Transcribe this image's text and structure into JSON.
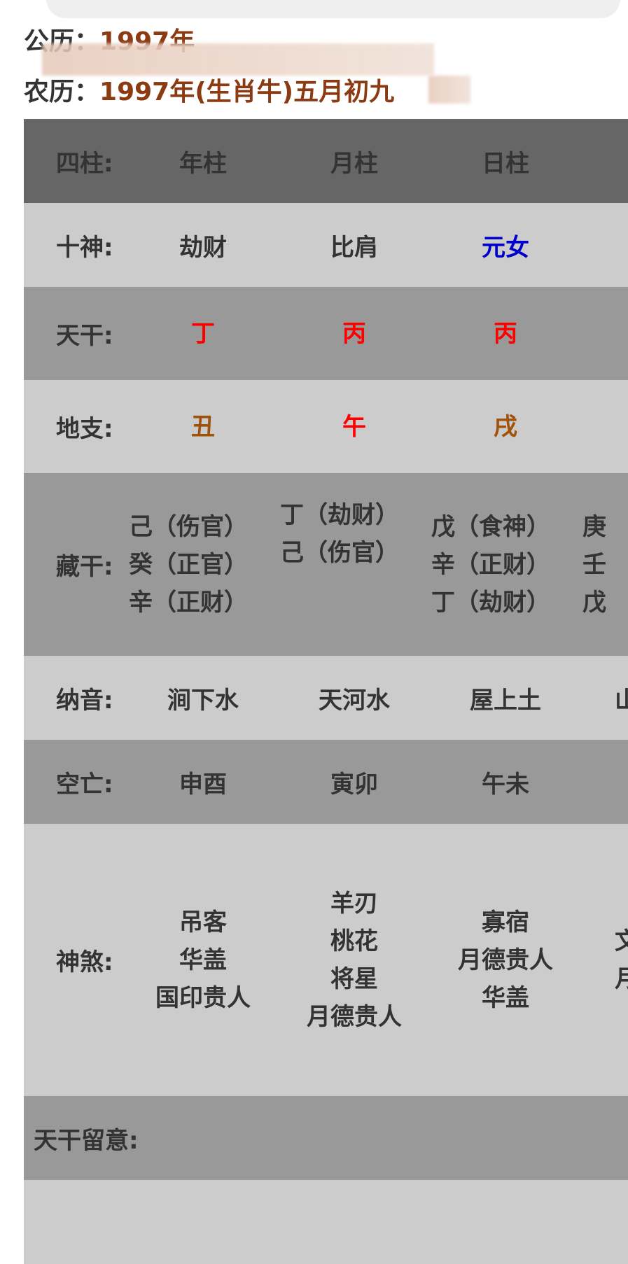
{
  "header": {
    "solar": {
      "label": "公历：",
      "value": "1997年"
    },
    "lunar": {
      "label": "农历：",
      "value": "1997年(生肖牛)五月初九"
    }
  },
  "table": {
    "pillars": {
      "label": "四柱:",
      "values": [
        "年柱",
        "月柱",
        "日柱",
        ""
      ]
    },
    "ten_gods": {
      "label": "十神:",
      "values": [
        "劫财",
        "比肩",
        "元女",
        ""
      ]
    },
    "heavenly_stems": {
      "label": "天干:",
      "values": [
        "丁",
        "丙",
        "丙",
        ""
      ]
    },
    "earthly_branches": {
      "label": "地支:",
      "values": [
        "丑",
        "午",
        "戌",
        ""
      ]
    },
    "hidden_stems": {
      "label": "藏干:",
      "values": [
        [
          "己（伤官）",
          "癸（正官）",
          "辛（正财）"
        ],
        [
          "丁（劫财）",
          "己（伤官）"
        ],
        [
          "戊（食神）",
          "辛（正财）",
          "丁（劫财）"
        ],
        [
          "庚",
          "壬",
          "戊"
        ]
      ]
    },
    "nayin": {
      "label": "纳音:",
      "values": [
        "涧下水",
        "天河水",
        "屋上土",
        "山"
      ]
    },
    "void": {
      "label": "空亡:",
      "values": [
        "申酉",
        "寅卯",
        "午未",
        ""
      ]
    },
    "shensha": {
      "label": "神煞:",
      "values": [
        [
          "吊客",
          "华盖",
          "国印贵人"
        ],
        [
          "羊刃",
          "桃花",
          "将星",
          "月德贵人"
        ],
        [
          "寡宿",
          "月德贵人",
          "华盖"
        ],
        [
          "文",
          "月"
        ]
      ]
    },
    "stem_notes": {
      "label": "天干留意:"
    }
  },
  "colors": {
    "fire_red": "#ff0000",
    "earth_brown": "#a0520a",
    "day_master_blue": "#0000cc",
    "date_value": "#8b3a12"
  }
}
